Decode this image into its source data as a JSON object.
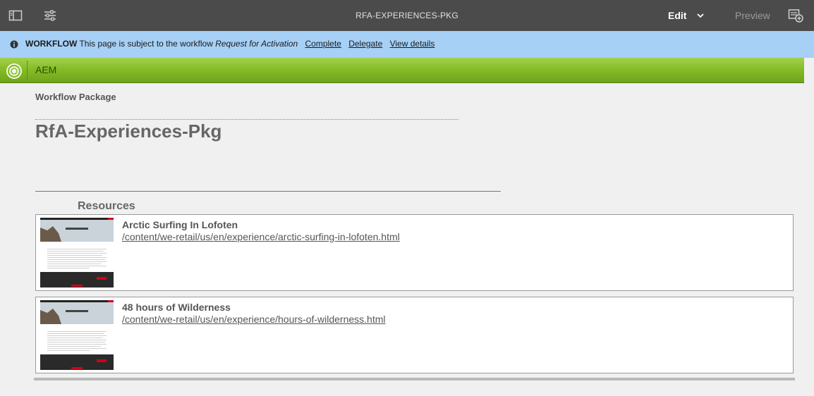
{
  "topbar": {
    "title": "RFA-EXPERIENCES-PKG",
    "mode_label": "Edit",
    "preview_label": "Preview",
    "icons": [
      "side-panel-icon",
      "page-properties-icon",
      "chevron-down-icon",
      "annotations-icon"
    ]
  },
  "workflow": {
    "label": "WORKFLOW",
    "message": "This page is subject to the workflow",
    "workflow_name": "Request for Activation",
    "actions": [
      "Complete",
      "Delegate",
      "View details"
    ]
  },
  "aem": {
    "label": "AEM"
  },
  "page": {
    "eyebrow": "Workflow Package",
    "title": "RfA-Experiences-Pkg",
    "resources_heading": "Resources"
  },
  "resources": [
    {
      "name": "Arctic Surfing In Lofoten",
      "path": "/content/we-retail/us/en/experience/arctic-surfing-in-lofoten.html"
    },
    {
      "name": "48 hours of Wilderness",
      "path": "/content/we-retail/us/en/experience/hours-of-wilderness.html"
    }
  ],
  "colors": {
    "toolbar": "#4b4b4b",
    "workflow_banner": "#a6d0f6",
    "aem_green": "#86bd27"
  }
}
